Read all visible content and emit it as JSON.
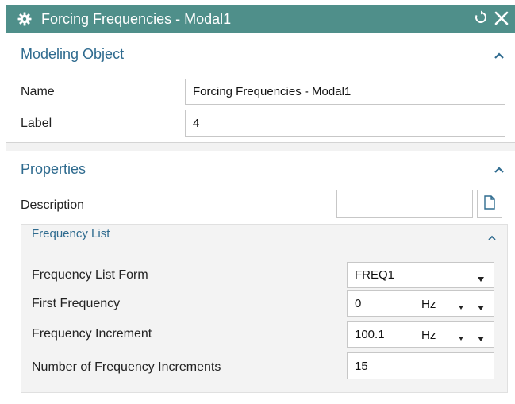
{
  "title": "Forcing Frequencies - Modal1",
  "icons": {
    "gear": "gear-icon",
    "reset": "reset-icon",
    "close": "close-icon",
    "collapse": "chevron-up-icon",
    "dropdown": "chevron-down-icon",
    "document": "document-icon"
  },
  "colors": {
    "titlebar": "#4f8f8a",
    "section_header": "#2f6b8f"
  },
  "modeling_object": {
    "header": "Modeling Object",
    "name_label": "Name",
    "name_value": "Forcing Frequencies - Modal1",
    "label_label": "Label",
    "label_value": "4"
  },
  "properties": {
    "header": "Properties",
    "description_label": "Description",
    "description_value": ""
  },
  "frequency_list": {
    "header": "Frequency List",
    "form_label": "Frequency List Form",
    "form_value": "FREQ1",
    "first_label": "First Frequency",
    "first_value": "0",
    "first_unit": "Hz",
    "increment_label": "Frequency Increment",
    "increment_value": "100.1",
    "increment_unit": "Hz",
    "count_label": "Number of Frequency Increments",
    "count_value": "15"
  }
}
